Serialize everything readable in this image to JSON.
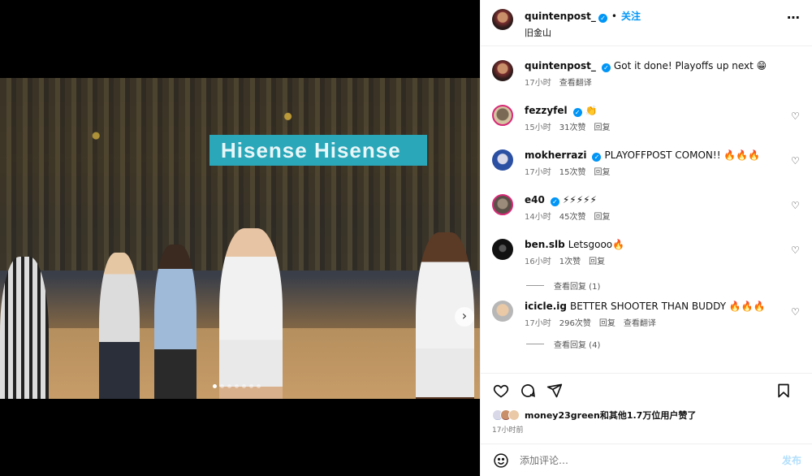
{
  "header": {
    "username": "quintenpost_",
    "separator": "•",
    "follow_label": "关注",
    "location": "旧金山",
    "more_icon": "more-horizontal-icon"
  },
  "media": {
    "banner_text": "Hisense Hisense",
    "carousel_count": 7,
    "carousel_active": 1
  },
  "caption": {
    "username": "quintenpost_",
    "text": "Got it done! Playoffs up next 😁",
    "time": "17小时",
    "translate": "查看翻译"
  },
  "comments": [
    {
      "username": "fezzyfel",
      "verified": true,
      "text": "👏",
      "time": "15小时",
      "likes": "31次赞",
      "reply": "回复"
    },
    {
      "username": "mokherrazi",
      "verified": true,
      "text": "PLAYOFFPOST COMON!! 🔥🔥🔥",
      "time": "17小时",
      "likes": "15次赞",
      "reply": "回复"
    },
    {
      "username": "e40",
      "verified": true,
      "text": "⚡⚡⚡⚡⚡",
      "time": "14小时",
      "likes": "45次赞",
      "reply": "回复"
    },
    {
      "username": "ben.slb",
      "verified": false,
      "text": "Letsgooo🔥",
      "time": "16小时",
      "likes": "1次赞",
      "reply": "回复",
      "view_replies": "查看回复 (1)"
    },
    {
      "username": "icicle.ig",
      "verified": false,
      "text": "BETTER SHOOTER THAN BUDDY 🔥🔥🔥",
      "time": "17小时",
      "likes": "296次赞",
      "reply": "回复",
      "translate": "查看翻译",
      "view_replies": "查看回复 (4)"
    }
  ],
  "actions": {
    "like_icon": "heart-icon",
    "comment_icon": "comment-icon",
    "share_icon": "send-icon",
    "save_icon": "bookmark-icon",
    "likes_text": "money23green和其他1.7万位用户赞了",
    "time": "17小时前"
  },
  "add_comment": {
    "placeholder": "添加评论…",
    "post_label": "发布",
    "emoji_icon": "emoji-icon"
  },
  "colors": {
    "accent": "#0095f6",
    "muted": "#737373",
    "post_disabled": "#b2dffc"
  }
}
